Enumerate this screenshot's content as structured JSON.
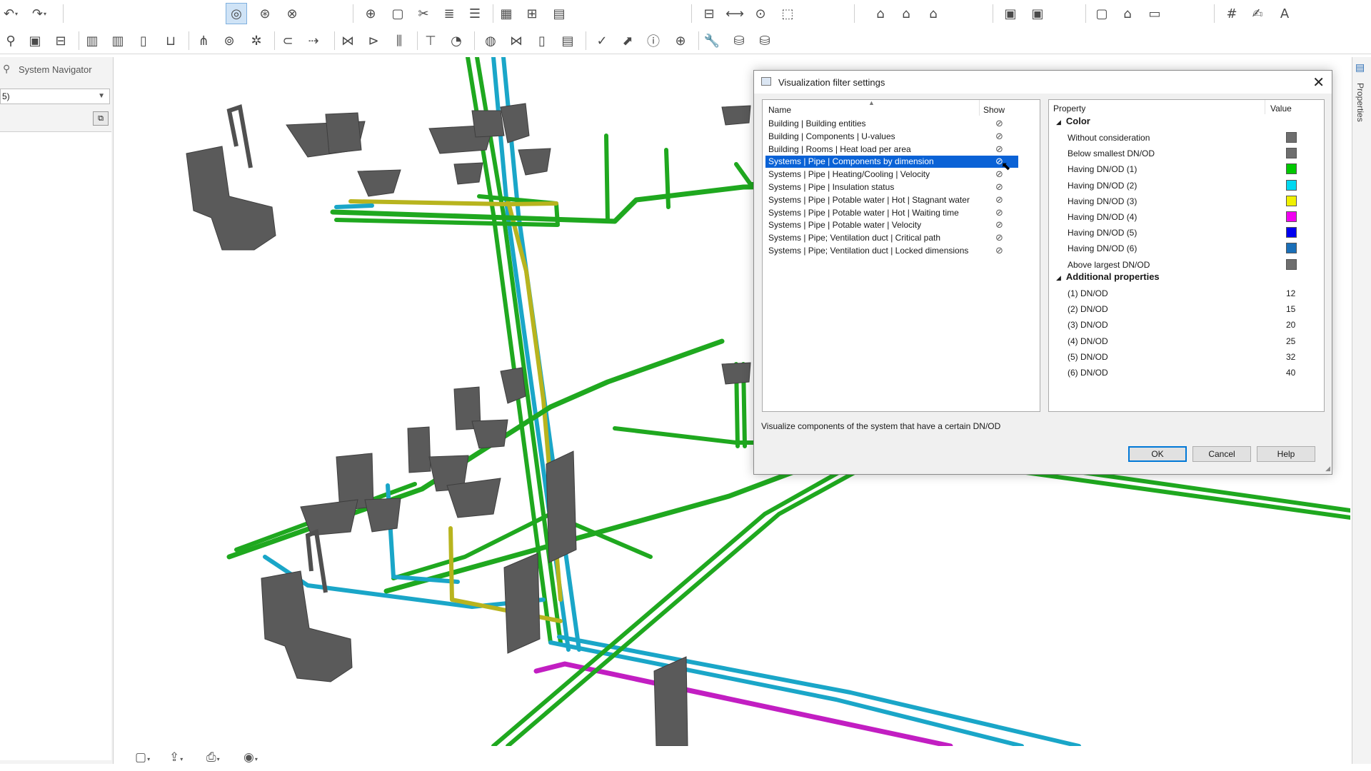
{
  "navigator": {
    "title": "System Navigator",
    "dropdown_value": "5)"
  },
  "properties_strip": {
    "label": "Properties"
  },
  "toolbar": {
    "row1": [
      "undo-icon",
      "redo-icon",
      "orbit-icon",
      "orbit-free-icon",
      "orbit-3d-icon",
      "zoom-icon",
      "view-cube-icon",
      "section-icon",
      "layers-icon",
      "layer-stack-icon",
      "grid-pattern-icon",
      "grid-snap-icon",
      "grid-table-icon",
      "dimension-icon",
      "measure-icon",
      "zoom-pick-icon",
      "select-area-icon",
      "house-icon",
      "house-floor-icon",
      "house-roof-icon",
      "document-export-icon",
      "document-settings-icon",
      "frame-icon",
      "building-icon",
      "monitor-icon",
      "numbering-icon",
      "handwriting-icon",
      "text-icon"
    ],
    "row2": [
      "pipe-route-icon",
      "boiler-icon",
      "tank-icon",
      "heat-pump-icon",
      "radiator-icon",
      "storage-icon",
      "container-icon",
      "manifold-icon",
      "pump-group-icon",
      "fan-icon",
      "coupling-icon",
      "connect-icon",
      "valve-icon",
      "flange-icon",
      "damper-icon",
      "meter-icon",
      "gauge-icon",
      "globe-valve-icon",
      "butterfly-valve-icon",
      "filter-icon",
      "panel-icon",
      "check-icon",
      "calculate-icon",
      "info-icon",
      "search-component-icon",
      "wrench-icon",
      "database-icon",
      "database-settings-icon"
    ]
  },
  "dialog": {
    "title": "Visualization filter settings",
    "list_headers": {
      "name": "Name",
      "show": "Show"
    },
    "filters": [
      {
        "label": "Building | Building entities",
        "selected": false
      },
      {
        "label": "Building | Components | U-values",
        "selected": false
      },
      {
        "label": "Building | Rooms | Heat load per area",
        "selected": false
      },
      {
        "label": "Systems | Pipe | Components by dimension",
        "selected": true
      },
      {
        "label": "Systems | Pipe | Heating/Cooling | Velocity",
        "selected": false
      },
      {
        "label": "Systems | Pipe | Insulation status",
        "selected": false
      },
      {
        "label": "Systems | Pipe | Potable water | Hot | Stagnant water",
        "selected": false
      },
      {
        "label": "Systems | Pipe | Potable water | Hot | Waiting time",
        "selected": false
      },
      {
        "label": "Systems | Pipe | Potable water | Velocity",
        "selected": false
      },
      {
        "label": "Systems | Pipe; Ventilation duct | Critical path",
        "selected": false
      },
      {
        "label": "Systems | Pipe; Ventilation duct | Locked dimensions",
        "selected": false
      }
    ],
    "property_headers": {
      "property": "Property",
      "value": "Value"
    },
    "color_section": "Color",
    "color_rows": [
      {
        "label": "Without consideration",
        "color": "#6e6e6e"
      },
      {
        "label": "Below smallest DN/OD",
        "color": "#6e6e6e"
      },
      {
        "label": "Having DN/OD (1)",
        "color": "#00c800"
      },
      {
        "label": "Having DN/OD (2)",
        "color": "#00d8f0"
      },
      {
        "label": "Having DN/OD (3)",
        "color": "#f0f000"
      },
      {
        "label": "Having DN/OD (4)",
        "color": "#f000f0"
      },
      {
        "label": "Having DN/OD (5)",
        "color": "#0000f0"
      },
      {
        "label": "Having DN/OD (6)",
        "color": "#1a6fb8"
      },
      {
        "label": "Above largest DN/OD",
        "color": "#6e6e6e"
      }
    ],
    "additional_section": "Additional properties",
    "additional_rows": [
      {
        "label": "(1) DN/OD",
        "value": "12"
      },
      {
        "label": "(2) DN/OD",
        "value": "15"
      },
      {
        "label": "(3) DN/OD",
        "value": "20"
      },
      {
        "label": "(4) DN/OD",
        "value": "25"
      },
      {
        "label": "(5) DN/OD",
        "value": "32"
      },
      {
        "label": "(6) DN/OD",
        "value": "40"
      }
    ],
    "description": "Visualize components of the system that have a certain DN/OD",
    "buttons": {
      "ok": "OK",
      "cancel": "Cancel",
      "help": "Help"
    }
  },
  "scene_colors": {
    "green": "#1fa81f",
    "cyan": "#1aa6c8",
    "yellow": "#b8b41e",
    "magenta": "#c21ec2",
    "fixture": "#5a5a5a"
  }
}
